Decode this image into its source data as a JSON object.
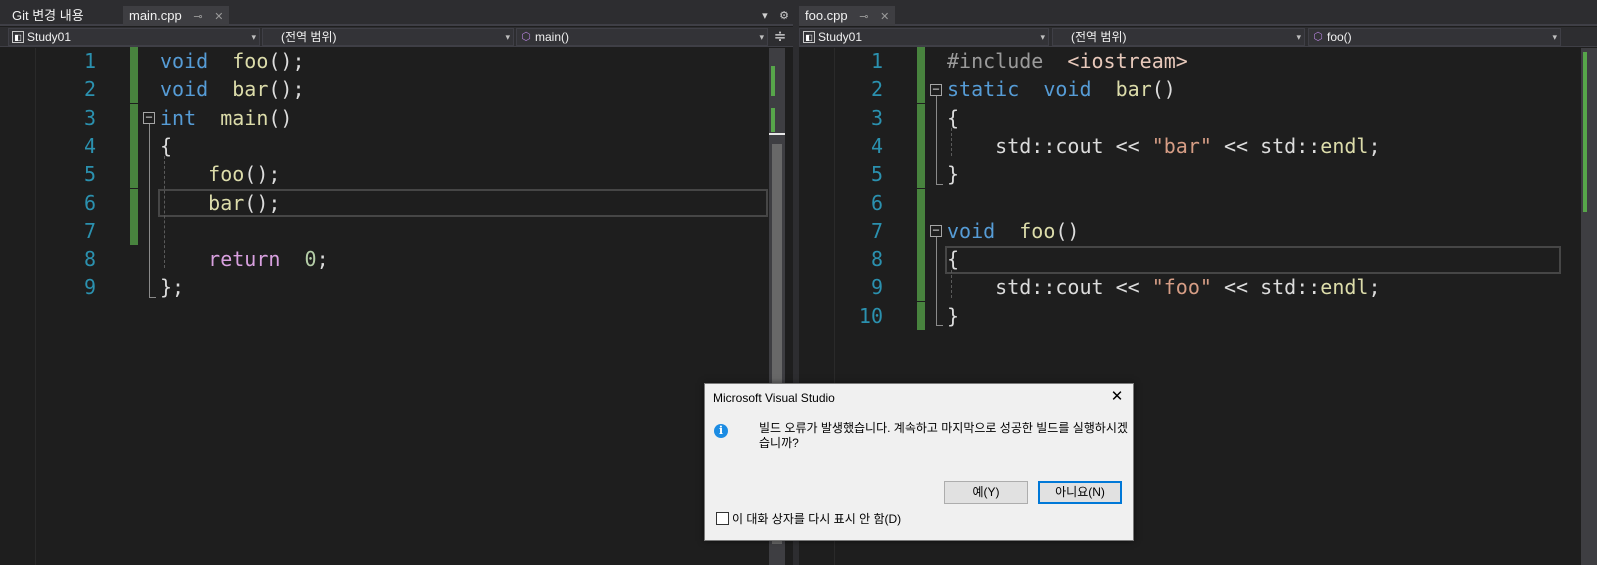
{
  "left_pane": {
    "tabs": [
      {
        "label": "Git 변경 내용",
        "active": false
      },
      {
        "label": "main.cpp",
        "active": true,
        "pin": "⊸",
        "close": "✕"
      }
    ],
    "tools": {
      "dropdown": "▾",
      "settings": "⚙"
    },
    "nav": {
      "project": "Study01",
      "scope": "(전역 범위)",
      "member": "main()",
      "split_glyph": "≑"
    },
    "lines": [
      {
        "n": "1",
        "code": [
          [
            "kw",
            "void"
          ],
          [
            "",
            "  "
          ],
          [
            "fn",
            "foo"
          ],
          [
            "",
            "();"
          ]
        ]
      },
      {
        "n": "2",
        "code": [
          [
            "kw",
            "void"
          ],
          [
            "",
            "  "
          ],
          [
            "fn",
            "bar"
          ],
          [
            "",
            "();"
          ]
        ]
      },
      {
        "n": "3",
        "code": [
          [
            "kw",
            "int"
          ],
          [
            "",
            "  "
          ],
          [
            "fn",
            "main"
          ],
          [
            "",
            "()"
          ]
        ]
      },
      {
        "n": "4",
        "code": [
          [
            "",
            "{"
          ]
        ]
      },
      {
        "n": "5",
        "code": [
          [
            "",
            "    "
          ],
          [
            "fn",
            "foo"
          ],
          [
            "",
            "();"
          ]
        ]
      },
      {
        "n": "6",
        "code": [
          [
            "",
            "    "
          ],
          [
            "fn",
            "bar"
          ],
          [
            "",
            "();"
          ]
        ]
      },
      {
        "n": "7",
        "code": []
      },
      {
        "n": "8",
        "code": [
          [
            "",
            "    "
          ],
          [
            "kw2",
            "return"
          ],
          [
            "",
            "  "
          ],
          [
            "num",
            "0"
          ],
          [
            "",
            ";"
          ]
        ]
      },
      {
        "n": "9",
        "code": [
          [
            "",
            "};"
          ]
        ]
      }
    ]
  },
  "right_pane": {
    "tabs": [
      {
        "label": "foo.cpp",
        "active": true,
        "pin": "⊸",
        "close": "✕"
      }
    ],
    "nav": {
      "project": "Study01",
      "scope": "(전역 범위)",
      "member": "foo()"
    },
    "lines": [
      {
        "n": "1",
        "code": [
          [
            "pp",
            "#include"
          ],
          [
            "",
            "  "
          ],
          [
            "inc",
            "<iostream>"
          ]
        ]
      },
      {
        "n": "2",
        "code": [
          [
            "kw",
            "static"
          ],
          [
            "",
            "  "
          ],
          [
            "kw",
            "void"
          ],
          [
            "",
            "  "
          ],
          [
            "fn",
            "bar"
          ],
          [
            "",
            "()"
          ]
        ]
      },
      {
        "n": "3",
        "code": [
          [
            "",
            "{"
          ]
        ]
      },
      {
        "n": "4",
        "code": [
          [
            "",
            "    std::cout << "
          ],
          [
            "str",
            "\"bar\""
          ],
          [
            "",
            " << std::"
          ],
          [
            "fn",
            "endl"
          ],
          [
            "",
            ";"
          ]
        ]
      },
      {
        "n": "5",
        "code": [
          [
            "",
            "}"
          ]
        ]
      },
      {
        "n": "6",
        "code": []
      },
      {
        "n": "7",
        "code": [
          [
            "kw",
            "void"
          ],
          [
            "",
            "  "
          ],
          [
            "fn",
            "foo"
          ],
          [
            "",
            "()"
          ]
        ]
      },
      {
        "n": "8",
        "code": [
          [
            "",
            "{"
          ]
        ]
      },
      {
        "n": "9",
        "code": [
          [
            "",
            "    std::cout << "
          ],
          [
            "str",
            "\"foo\""
          ],
          [
            "",
            " << std::"
          ],
          [
            "fn",
            "endl"
          ],
          [
            "",
            ";"
          ]
        ]
      },
      {
        "n": "10",
        "code": [
          [
            "",
            "}"
          ]
        ]
      }
    ]
  },
  "dialog": {
    "title": "Microsoft Visual Studio",
    "close": "✕",
    "icon": "i",
    "message": "빌드 오류가 발생했습니다. 계속하고 마지막으로 성공한 빌드를 실행하시겠습니까?",
    "yes_label": "예(Y)",
    "no_label": "아니요(N)",
    "checkbox_label": "이 대화 상자를 다시 표시 안 함(D)"
  },
  "colors": {
    "keyword": "#569cd6",
    "control_keyword": "#d8a0df",
    "function": "#dcdcaa",
    "string": "#d69d85",
    "number": "#b5cea8",
    "line_number": "#2b91af",
    "change_bar": "#57a64a",
    "editor_bg": "#1e1e1e",
    "dialog_accent": "#0078d7"
  }
}
